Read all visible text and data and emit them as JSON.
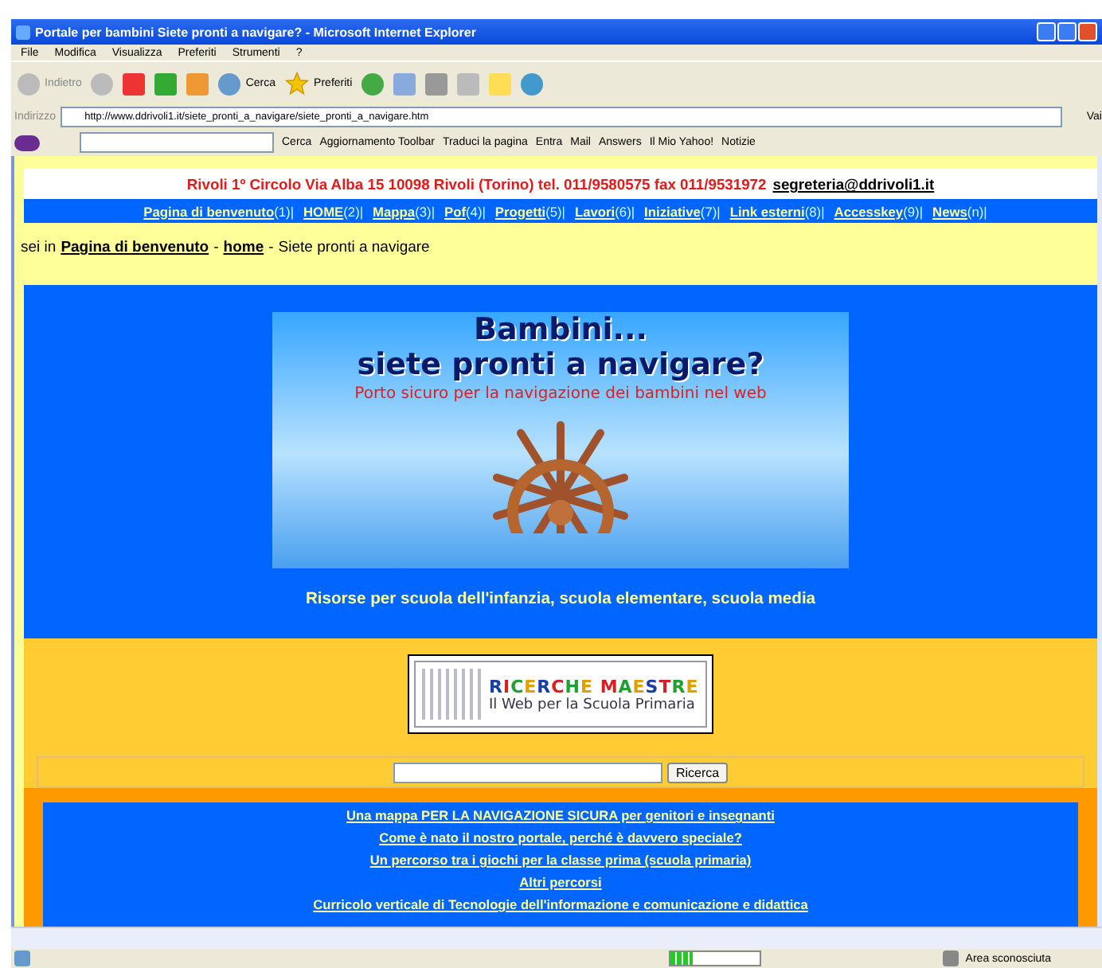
{
  "window": {
    "title": "Portale per bambini Siete pronti a navigare? - Microsoft Internet Explorer"
  },
  "menu": [
    "File",
    "Modifica",
    "Visualizza",
    "Preferiti",
    "Strumenti",
    "?"
  ],
  "toolbar": {
    "back": "Indietro",
    "search": "Cerca",
    "favorites": "Preferiti"
  },
  "address": {
    "label": "Indirizzo",
    "value": "http://www.ddrivoli1.it/siete_pronti_a_navigare/siete_pronti_a_navigare.htm",
    "go": "Vai"
  },
  "yahoo_bar": {
    "search": "Cerca",
    "items": [
      "Aggiornamento Toolbar",
      "Traduci la pagina",
      "Entra",
      "Mail",
      "Answers",
      "Il Mio Yahoo!",
      "Notizie"
    ]
  },
  "page": {
    "header": {
      "address": "Rivoli 1º Circolo Via Alba 15 10098 Rivoli (Torino) tel. 011/9580575 fax 011/9531972",
      "email": "segreteria@ddrivoli1.it"
    },
    "nav": [
      {
        "label": "Pagina di benvenuto ",
        "key": "(1)|"
      },
      {
        "label": "HOME ",
        "key": "(2)|"
      },
      {
        "label": "Mappa",
        "key": " (3)|"
      },
      {
        "label": "Pof",
        "key": " (4)|"
      },
      {
        "label": "Progetti",
        "key": " (5)|"
      },
      {
        "label": "Lavori",
        "key": " (6)|"
      },
      {
        "label": "Iniziative",
        "key": " (7)|"
      },
      {
        "label": "Link esterni",
        "key": " (8)|"
      },
      {
        "label": "Accesskey",
        "key": " (9)|"
      },
      {
        "label": "News",
        "key": "(n)|"
      }
    ],
    "breadcrumb": {
      "prefix": "sei in",
      "links": [
        {
          "label": "Pagina di benvenuto",
          "sep": "-"
        },
        {
          "label": "home",
          "sep": "-"
        }
      ],
      "current": "Siete pronti a navigare"
    },
    "banner": {
      "title_1": "Bambini...",
      "title_2": "siete pronti a navigare?",
      "subtitle": "Porto sicuro per la navigazione dei bambini nel web"
    },
    "tagline": "Risorse per scuola dell'infanzia, scuola elementare, scuola media",
    "logo": {
      "title": "RICERCHE MAESTRE",
      "subtitle": "Il Web per la Scuola Primaria"
    },
    "search_button": "Ricerca",
    "links": [
      "Una mappa PER LA NAVIGAZIONE SICURA per genitori e insegnanti",
      "Come è nato il nostro portale, perché è davvero speciale?",
      "Un percorso tra i giochi per la classe prima (scuola primaria)",
      "Altri percorsi",
      "Curricolo verticale di Tecnologie dell'informazione e comunicazione e didattica"
    ]
  },
  "status_bar": {
    "level": 0.25,
    "zone": "Area sconosciuta"
  }
}
